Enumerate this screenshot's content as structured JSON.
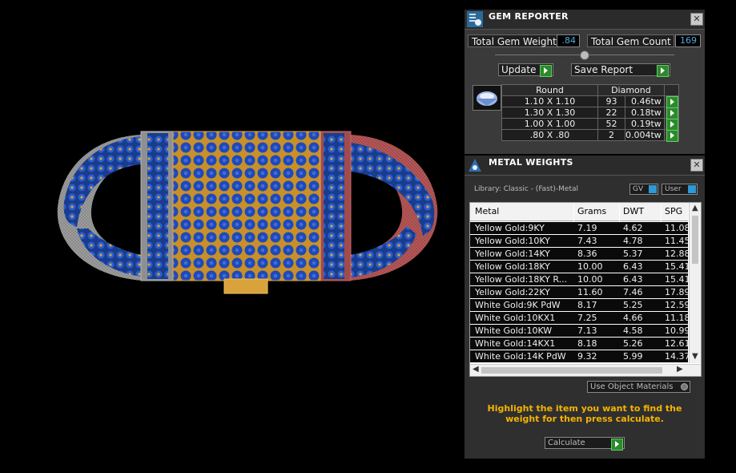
{
  "gem_reporter": {
    "title": "GEM REPORTER",
    "total_weight_label": "Total Gem Weight",
    "total_weight_value": ".84",
    "total_count_label": "Total Gem Count",
    "total_count_value": "169",
    "update_label": "Update",
    "save_report_label": "Save Report",
    "shape": "Round",
    "material": "Diamond",
    "rows": [
      {
        "size": "1.10 X 1.10",
        "count": "93",
        "weight": "0.46tw"
      },
      {
        "size": "1.30 X 1.30",
        "count": "22",
        "weight": "0.18tw"
      },
      {
        "size": "1.00 X 1.00",
        "count": "52",
        "weight": "0.19tw"
      },
      {
        "size": ".80 X .80",
        "count": "2",
        "weight": "0.004tw"
      }
    ]
  },
  "metal_weights": {
    "title": "METAL WEIGHTS",
    "library": "Library: Classic - (Fast)-Metal",
    "gv_label": "GV",
    "user_label": "User",
    "columns": [
      "Metal",
      "Grams",
      "DWT",
      "SPG"
    ],
    "rows": [
      {
        "metal": "Yellow Gold:9KY",
        "grams": "7.19",
        "dwt": "4.62",
        "spg": "11.08"
      },
      {
        "metal": "Yellow Gold:10KY",
        "grams": "7.43",
        "dwt": "4.78",
        "spg": "11.45"
      },
      {
        "metal": "Yellow Gold:14KY",
        "grams": "8.36",
        "dwt": "5.37",
        "spg": "12.88"
      },
      {
        "metal": "Yellow Gold:18KY",
        "grams": "10.00",
        "dwt": "6.43",
        "spg": "15.41"
      },
      {
        "metal": "Yellow Gold:18KY R...",
        "grams": "10.00",
        "dwt": "6.43",
        "spg": "15.41"
      },
      {
        "metal": "Yellow Gold:22KY",
        "grams": "11.60",
        "dwt": "7.46",
        "spg": "17.89"
      },
      {
        "metal": "White Gold:9K PdW",
        "grams": "8.17",
        "dwt": "5.25",
        "spg": "12.59"
      },
      {
        "metal": "White Gold:10KX1",
        "grams": "7.25",
        "dwt": "4.66",
        "spg": "11.18"
      },
      {
        "metal": "White Gold:10KW",
        "grams": "7.13",
        "dwt": "4.58",
        "spg": "10.99"
      },
      {
        "metal": "White Gold:14KX1",
        "grams": "8.18",
        "dwt": "5.26",
        "spg": "12.61"
      },
      {
        "metal": "White Gold:14K PdW",
        "grams": "9.32",
        "dwt": "5.99",
        "spg": "14.37"
      }
    ],
    "use_object_materials_label": "Use Object Materials",
    "hint": "Highlight the item you want to find the weight for then press calculate.",
    "calculate_label": "Calculate"
  },
  "colors": {
    "accent_green": "#2c8a2c",
    "hint_yellow": "#f4b400",
    "value_blue": "#55aadd"
  },
  "icons": [
    "gem-reporter-icon",
    "metal-weights-icon",
    "close-icon",
    "play-arrow-icon",
    "gem-thumbnail-icon"
  ]
}
